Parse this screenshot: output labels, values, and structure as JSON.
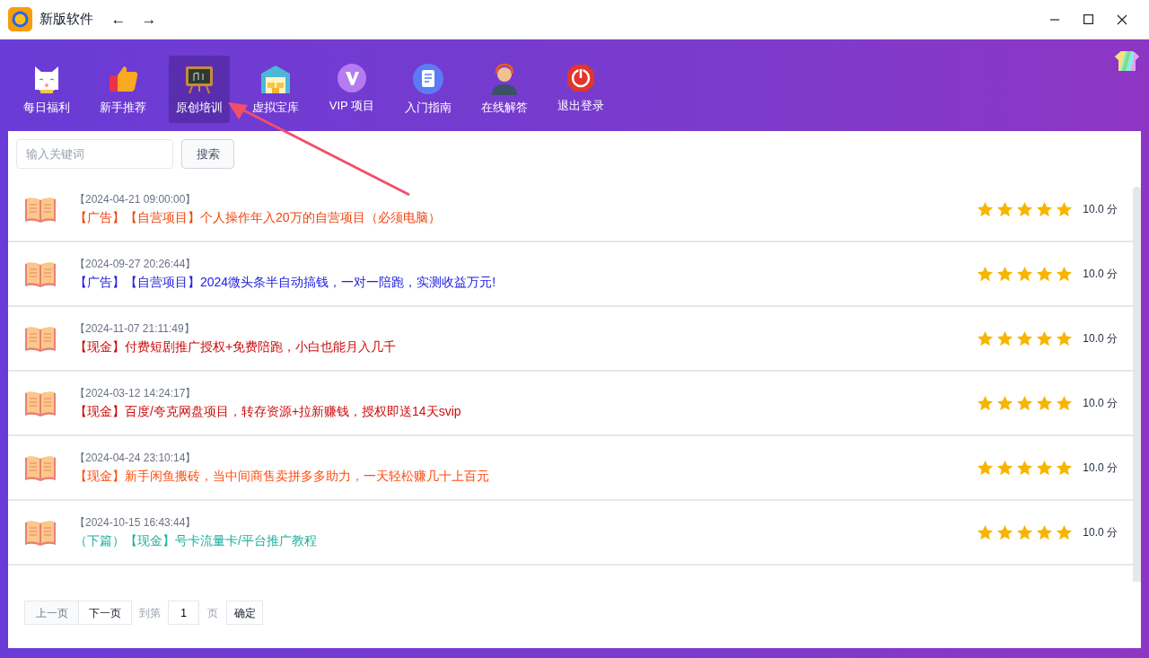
{
  "window": {
    "title": "新版软件",
    "back": "←",
    "forward": "→"
  },
  "nav": [
    {
      "label": "每日福利",
      "kind": "cat",
      "selected": false
    },
    {
      "label": "新手推荐",
      "kind": "thumb",
      "selected": false
    },
    {
      "label": "原创培训",
      "kind": "board",
      "selected": true
    },
    {
      "label": "虚拟宝库",
      "kind": "warehouse",
      "selected": false
    },
    {
      "label": "VIP 项目",
      "kind": "vip",
      "selected": false
    },
    {
      "label": "入门指南",
      "kind": "doc",
      "selected": false
    },
    {
      "label": "在线解答",
      "kind": "agent",
      "selected": false
    },
    {
      "label": "退出登录",
      "kind": "power",
      "selected": false
    }
  ],
  "search": {
    "placeholder": "输入关键词",
    "button": "搜索"
  },
  "articles": [
    {
      "date": "【2024-04-21 09:00:00】",
      "title": "【广告】【自营项目】个人操作年入20万的自营项目（必须电脑）",
      "color": "#f0440e",
      "stars": 5,
      "score": "10.0 分"
    },
    {
      "date": "【2024-09-27 20:26:44】",
      "title": "【广告】【自营项目】2024微头条半自动搞钱，一对一陪跑，实测收益万元!",
      "color": "#2020e0",
      "stars": 5,
      "score": "10.0 分"
    },
    {
      "date": "【2024-11-07 21:11:49】",
      "title": "【现金】付费短剧推广授权+免费陪跑，小白也能月入几千",
      "color": "#cc0a0a",
      "stars": 5,
      "score": "10.0 分"
    },
    {
      "date": "【2024-03-12 14:24:17】",
      "title": "【现金】百度/夸克网盘项目，转存资源+拉新赚钱，授权即送14天svip",
      "color": "#cc0a0a",
      "stars": 5,
      "score": "10.0 分"
    },
    {
      "date": "【2024-04-24 23:10:14】",
      "title": "【现金】新手闲鱼搬砖，当中间商售卖拼多多助力，一天轻松赚几十上百元",
      "color": "#ff4d0f",
      "stars": 5,
      "score": "10.0 分"
    },
    {
      "date": "【2024-10-15 16:43:44】",
      "title": "（下篇）【现金】号卡流量卡/平台推广教程",
      "color": "#20b0a0",
      "stars": 5,
      "score": "10.0 分"
    }
  ],
  "pagination": {
    "prev": "上一页",
    "next": "下一页",
    "goto": "到第",
    "page": "1",
    "unit": "页",
    "confirm": "确定",
    "prev_disabled": true
  }
}
